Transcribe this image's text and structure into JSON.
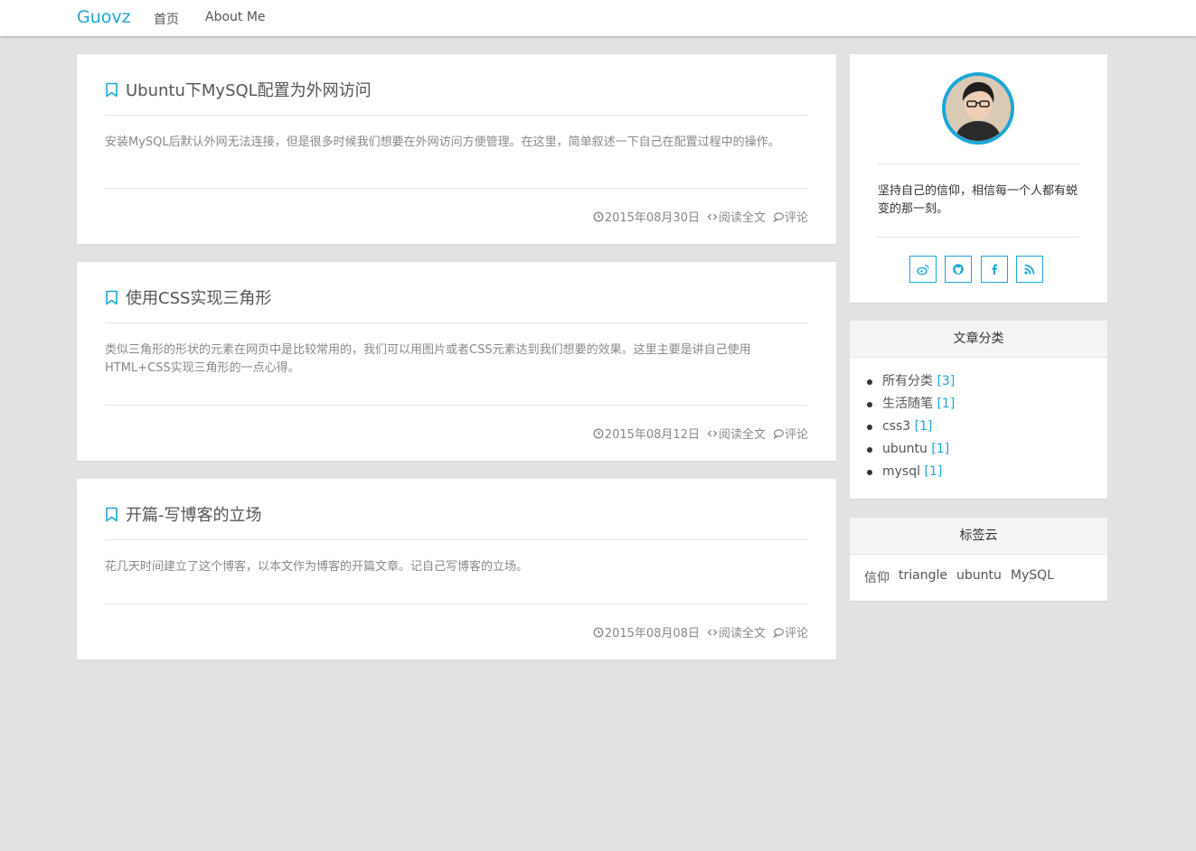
{
  "nav": {
    "brand": "Guovz",
    "links": [
      {
        "label": "首页"
      },
      {
        "label": "About Me"
      }
    ]
  },
  "posts": [
    {
      "title": "Ubuntu下MySQL配置为外网访问",
      "excerpt": "安装MySQL后默认外网无法连接，但是很多时候我们想要在外网访问方便管理。在这里，简单叙述一下自己在配置过程中的操作。",
      "date": "2015年08月30日",
      "read_more": "阅读全文",
      "comments": "评论"
    },
    {
      "title": "使用CSS实现三角形",
      "excerpt": "类似三角形的形状的元素在网页中是比较常用的，我们可以用图片或者CSS元素达到我们想要的效果。这里主要是讲自己使用HTML+CSS实现三角形的一点心得。",
      "date": "2015年08月12日",
      "read_more": "阅读全文",
      "comments": "评论"
    },
    {
      "title": "开篇-写博客的立场",
      "excerpt": "花几天时间建立了这个博客，以本文作为博客的开篇文章。记自己写博客的立场。",
      "date": "2015年08月08日",
      "read_more": "阅读全文",
      "comments": "评论"
    }
  ],
  "profile": {
    "motto": "坚持自己的信仰，相信每一个人都有蜕变的那一刻。",
    "social_icons": [
      "weibo-icon",
      "github-icon",
      "facebook-icon",
      "rss-icon"
    ]
  },
  "categories": {
    "title": "文章分类",
    "items": [
      {
        "name": "所有分类",
        "count": "[3]"
      },
      {
        "name": "生活随笔",
        "count": "[1]"
      },
      {
        "name": "css3",
        "count": "[1]"
      },
      {
        "name": "ubuntu",
        "count": "[1]"
      },
      {
        "name": "mysql",
        "count": "[1]"
      }
    ]
  },
  "tag_cloud": {
    "title": "标签云",
    "tags": [
      "信仰",
      "triangle",
      "ubuntu",
      "MySQL"
    ]
  },
  "colors": {
    "accent": "#1ba7d8",
    "background": "#e2e2e2",
    "card": "#ffffff"
  }
}
